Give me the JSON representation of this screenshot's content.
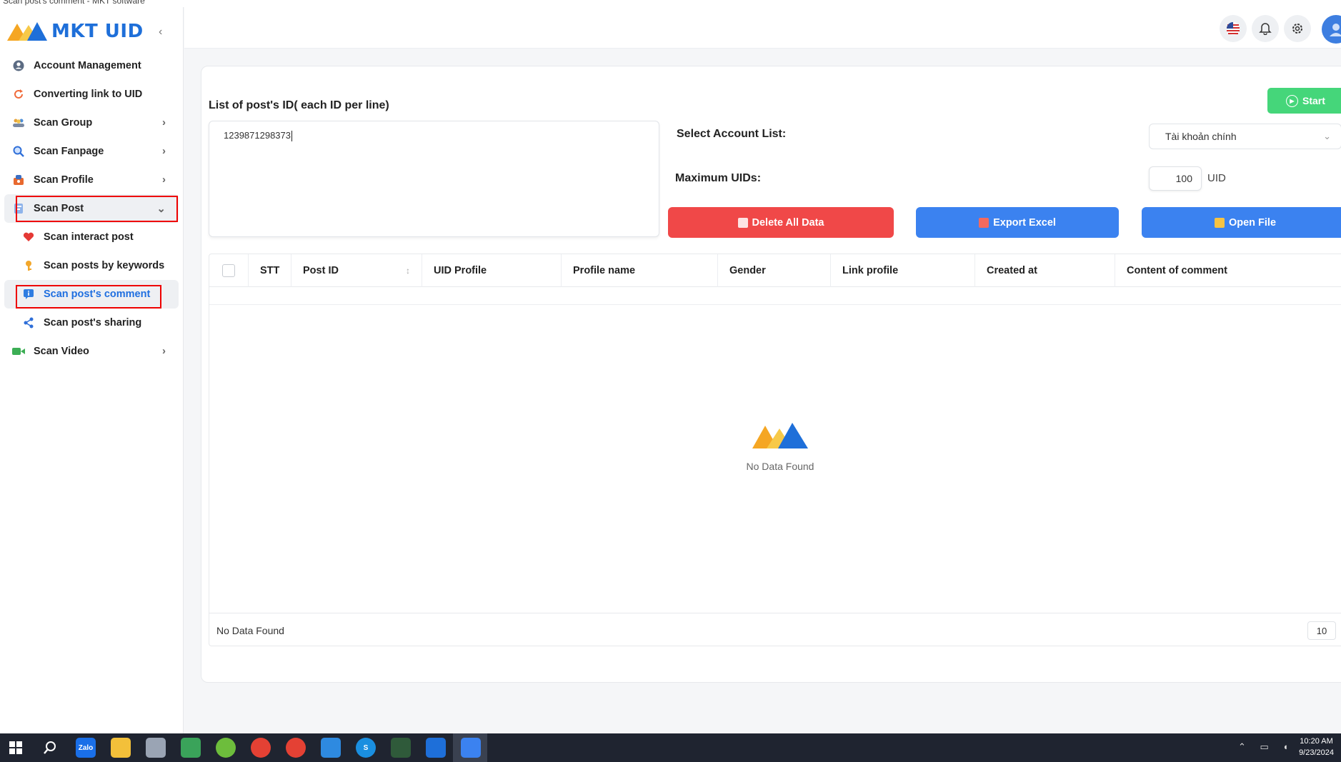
{
  "window": {
    "title": "Scan post's comment - MKT software"
  },
  "brand": {
    "name": "MKT UID"
  },
  "sidebar": {
    "items": [
      {
        "label": "Account Management",
        "icon": "user-circle-icon"
      },
      {
        "label": "Converting link to UID",
        "icon": "refresh-icon"
      },
      {
        "label": "Scan Group",
        "icon": "group-icon"
      },
      {
        "label": "Scan Fanpage",
        "icon": "search-icon"
      },
      {
        "label": "Scan Profile",
        "icon": "profile-icon"
      },
      {
        "label": "Scan Post",
        "icon": "post-icon"
      },
      {
        "label": "Scan interact post",
        "icon": "heart-icon"
      },
      {
        "label": "Scan posts by keywords",
        "icon": "key-icon"
      },
      {
        "label": "Scan post's comment",
        "icon": "comment-icon"
      },
      {
        "label": "Scan post's sharing",
        "icon": "share-icon"
      },
      {
        "label": "Scan Video",
        "icon": "video-icon"
      }
    ]
  },
  "form": {
    "post_ids_label": "List of post's ID( each ID per line)",
    "post_ids_value": "1239871298373",
    "account_list_label": "Select Account List:",
    "account_list_value": "Tài khoản chính",
    "max_uids_label": "Maximum UIDs:",
    "max_uids_value": "100",
    "max_uids_unit": "UID"
  },
  "actions": {
    "start": "Start",
    "delete_all": "Delete All Data",
    "export_excel": "Export Excel",
    "open_file": "Open File"
  },
  "table": {
    "columns": [
      "STT",
      "Post ID",
      "UID Profile",
      "Profile name",
      "Gender",
      "Link profile",
      "Created at",
      "Content of comment"
    ],
    "empty_text": "No Data Found",
    "footer_text": "No Data Found",
    "page_size": "10"
  },
  "taskbar": {
    "time": "10:20 AM",
    "date": "9/23/2024"
  },
  "colors": {
    "brand_blue": "#1e6fd9",
    "danger": "#f04848",
    "primary": "#3b82f0",
    "success": "#45d67a",
    "highlight_box": "#e00000"
  }
}
